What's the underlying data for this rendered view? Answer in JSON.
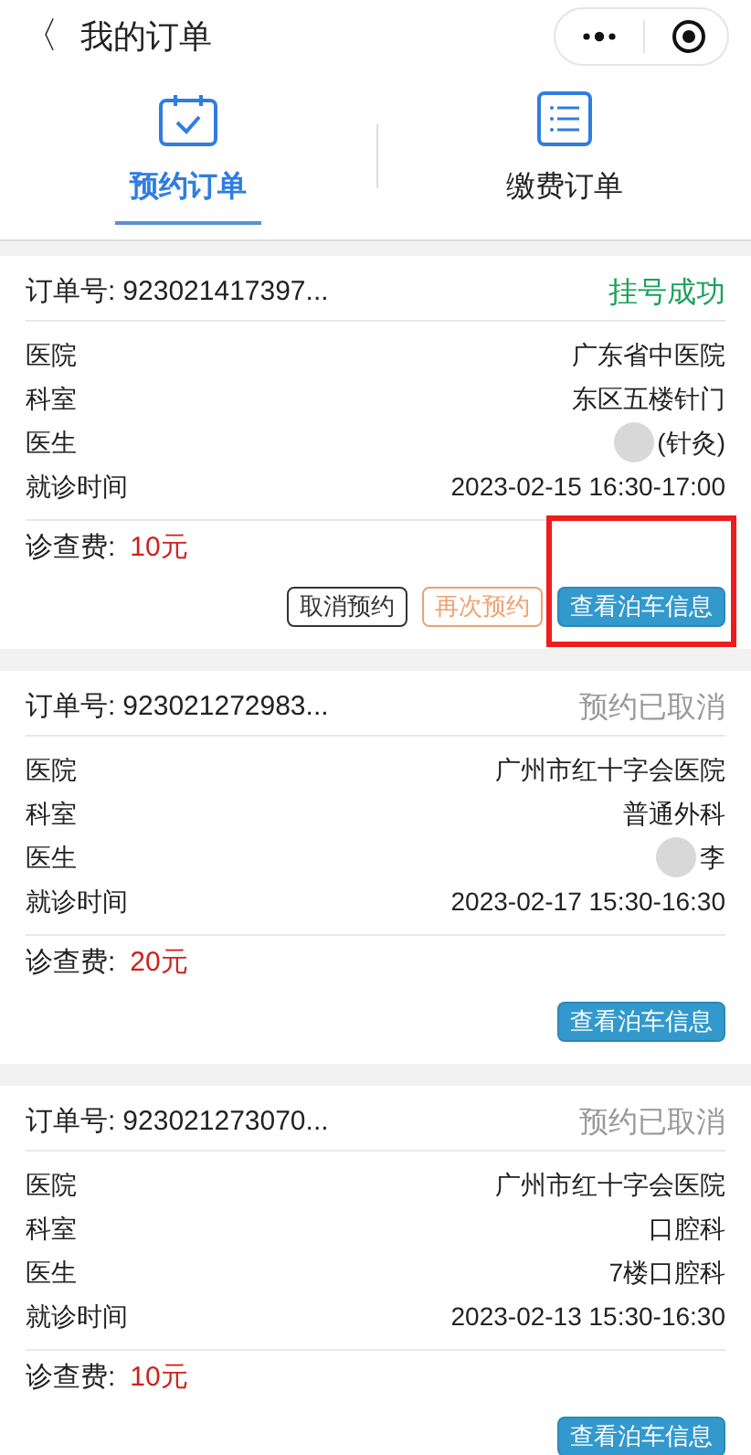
{
  "header": {
    "back": "〈",
    "title": "我的订单"
  },
  "tabs": [
    {
      "label": "预约订单",
      "kind": "calendar",
      "selected": true
    },
    {
      "label": "缴费订单",
      "kind": "list",
      "selected": false
    }
  ],
  "orders": [
    {
      "order_no_label": "订单号:",
      "order_no": "923021417397...",
      "status": "挂号成功",
      "kind": "success",
      "fields": [
        {
          "label": "医院",
          "value": "广东省中医院"
        },
        {
          "label": "科室",
          "value": "东区五楼针门"
        },
        {
          "label": "医生",
          "value": "(针灸)",
          "blurred": true
        },
        {
          "label": "就诊时间",
          "value": "2023-02-15 16:30-17:00"
        }
      ],
      "fee_label": "诊查费:",
      "fee": "10元",
      "buttons": [
        {
          "label": "取消预约",
          "kind": "outline"
        },
        {
          "label": "再次预约",
          "kind": "warm"
        },
        {
          "label": "查看泊车信息",
          "kind": "primary",
          "highlighted": true
        }
      ]
    },
    {
      "order_no_label": "订单号:",
      "order_no": "923021272983...",
      "status": "预约已取消",
      "kind": "cancelled",
      "fields": [
        {
          "label": "医院",
          "value": "广州市红十字会医院"
        },
        {
          "label": "科室",
          "value": "普通外科"
        },
        {
          "label": "医生",
          "value": "李",
          "blurred": true
        },
        {
          "label": "就诊时间",
          "value": "2023-02-17 15:30-16:30"
        }
      ],
      "fee_label": "诊查费:",
      "fee": "20元",
      "buttons": [
        {
          "label": "查看泊车信息",
          "kind": "primary",
          "highlighted": false
        }
      ]
    },
    {
      "order_no_label": "订单号:",
      "order_no": "923021273070...",
      "status": "预约已取消",
      "kind": "cancelled",
      "fields": [
        {
          "label": "医院",
          "value": "广州市红十字会医院"
        },
        {
          "label": "科室",
          "value": "口腔科"
        },
        {
          "label": "医生",
          "value": "7楼口腔科",
          "blurred": false
        },
        {
          "label": "就诊时间",
          "value": "2023-02-13 15:30-16:30"
        }
      ],
      "fee_label": "诊查费:",
      "fee": "10元",
      "buttons": [
        {
          "label": "查看泊车信息",
          "kind": "primary",
          "highlighted": false
        }
      ]
    }
  ]
}
